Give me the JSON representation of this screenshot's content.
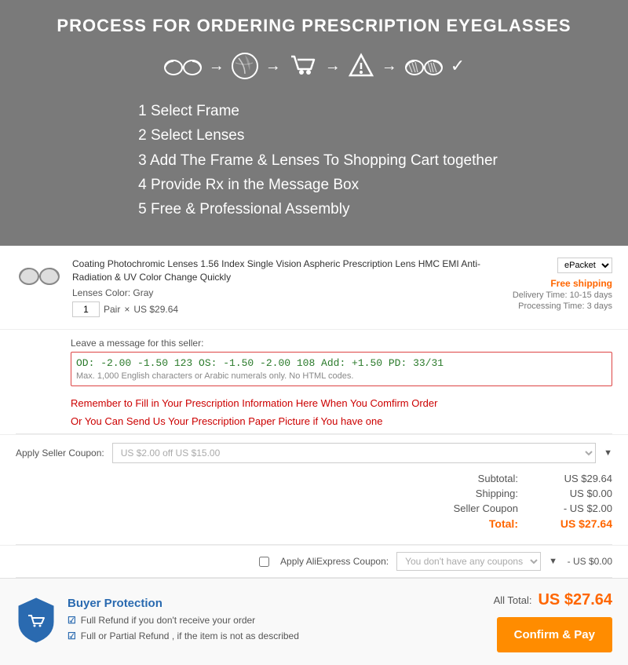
{
  "header": {
    "title": "PROCESS FOR ORDERING PRESCRIPTION EYEGLASSES",
    "steps": [
      {
        "num": "1",
        "label": "Select Frame"
      },
      {
        "num": "2",
        "label": "Select Lenses"
      },
      {
        "num": "3",
        "label": "Add The Frame & Lenses To Shopping Cart together"
      },
      {
        "num": "4",
        "label": "Provide Rx in the Message Box"
      },
      {
        "num": "5",
        "label": "Free & Professional Assembly"
      }
    ],
    "icons": [
      "glasses",
      "lens",
      "cart",
      "warning",
      "rx-glasses",
      "checkmark"
    ]
  },
  "product": {
    "name": "Coating Photochromic Lenses 1.56 Index Single Vision Aspheric Prescription Lens HMC EMI Anti-Radiation & UV Color Change Quickly",
    "lens_color_label": "Lenses Color:",
    "lens_color": "Gray",
    "quantity": "1",
    "unit": "Pair",
    "unit_price": "US $29.64",
    "shipping_method": "ePacket",
    "free_shipping": "Free shipping",
    "delivery_label": "Delivery Time: 10-15 days",
    "processing_label": "Processing Time: 3 days"
  },
  "message": {
    "label": "Leave a message for this seller:",
    "content": "OD: -2.00  -1.50  123    OS: -1.50  -2.00  108   Add: +1.50  PD: 33/31",
    "char_note": "Max. 1,000 English characters or Arabic numerals only. No HTML codes."
  },
  "warnings": {
    "msg1": "Remember to Fill in Your Prescription Information Here When You Comfirm Order",
    "msg2": "Or You Can Send Us Your Prescription Paper Picture if You have one"
  },
  "coupon": {
    "label": "Apply Seller Coupon:",
    "placeholder": "US $2.00 off US $15.00"
  },
  "summary": {
    "subtotal_label": "Subtotal:",
    "subtotal_value": "US $29.64",
    "shipping_label": "Shipping:",
    "shipping_value": "US $0.00",
    "seller_coupon_label": "Seller Coupon",
    "seller_coupon_value": "- US $2.00",
    "total_label": "Total:",
    "total_value": "US $27.64"
  },
  "ali_coupon": {
    "checkbox_label": "Apply AliExpress Coupon:",
    "placeholder": "You don't have any coupons",
    "amount": "- US $0.00"
  },
  "footer": {
    "protection_title": "Buyer Protection",
    "protection_items": [
      "Full Refund if you don't receive your order",
      "Full or Partial Refund , if the item is not as described"
    ],
    "all_total_label": "All Total:",
    "all_total_amount": "US $27.64",
    "confirm_pay_label": "Confirm & Pay"
  }
}
